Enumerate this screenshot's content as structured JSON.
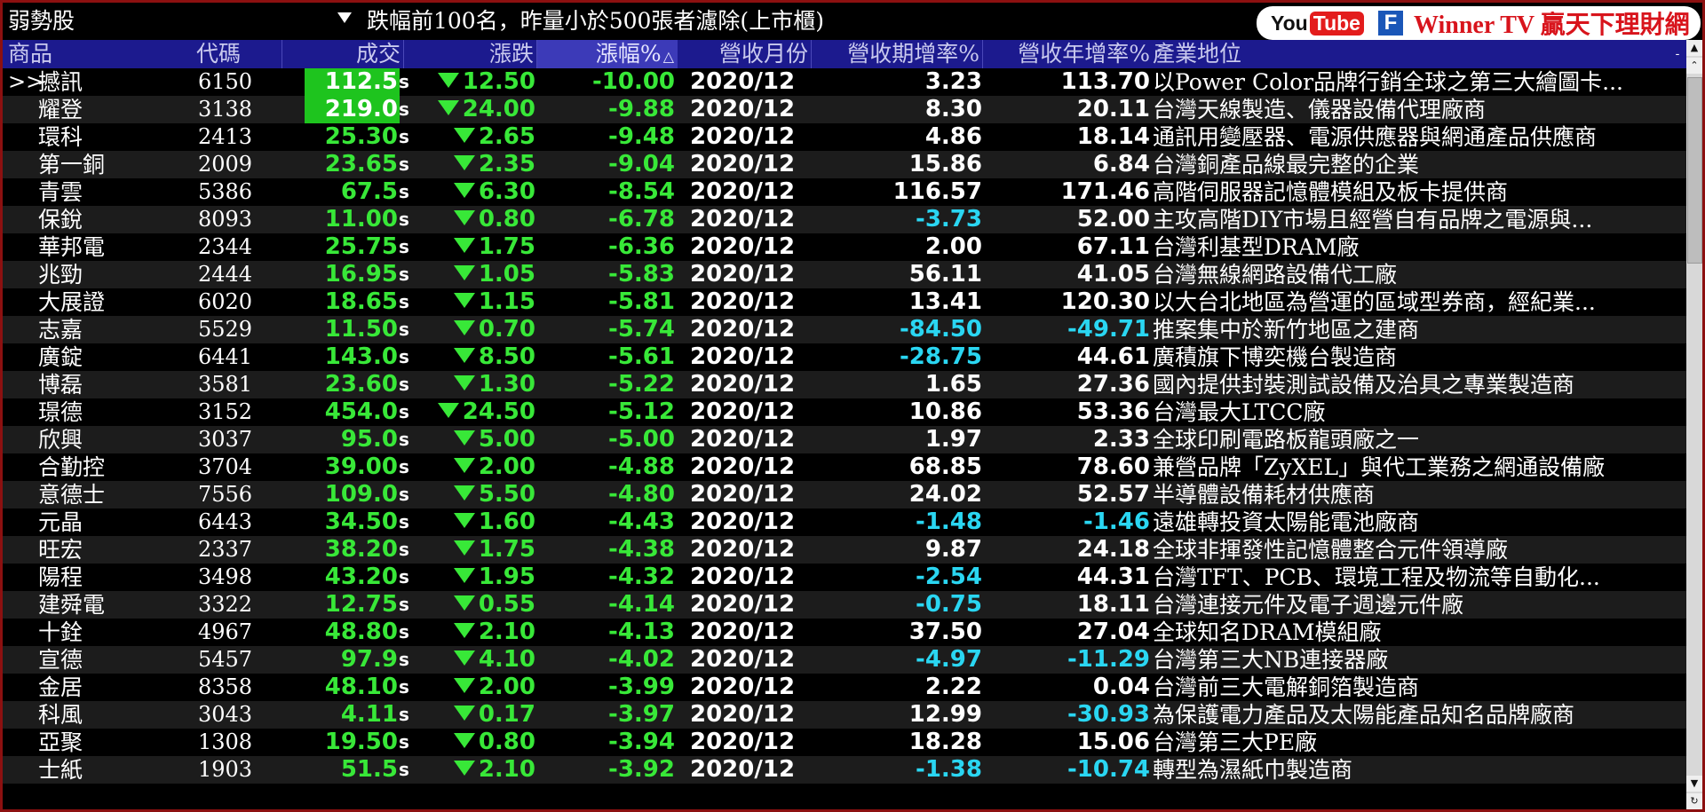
{
  "window": {
    "title_left": "弱勢股",
    "title_center": "跌幅前100名，昨量小於500張者濾除(上市櫃)"
  },
  "banner": {
    "you": "You",
    "tube": "Tube",
    "fb": "F",
    "brand": "Winner TV 贏天下理財網"
  },
  "columns": {
    "name": "商品",
    "code": "代碼",
    "price": "成交",
    "change": "漲跌",
    "pct": "漲幅%",
    "pct_sort_icon": "△",
    "month": "營收月份",
    "mom": "營收期增率%",
    "yoy": "營收年增率%",
    "industry": "產業地位"
  },
  "colors": {
    "down_green": "#38e838",
    "negative_cyan": "#2ad6f2",
    "header_blue": "#1c1a8e",
    "highlight_green": "#1ec41e"
  },
  "rows": [
    {
      "ptr": ">>",
      "name": "撼訊",
      "code": "6150",
      "price": "112.5",
      "s": "s",
      "chg": "12.50",
      "pct": "-10.00",
      "month": "2020/12",
      "mom": "3.23",
      "yoy": "113.70",
      "ind": "以Power Color品牌行銷全球之第三大繪圖卡..."
    },
    {
      "ptr": "",
      "name": "耀登",
      "code": "3138",
      "price": "219.0",
      "s": "s",
      "chg": "24.00",
      "pct": "-9.88",
      "month": "2020/12",
      "mom": "8.30",
      "yoy": "20.11",
      "ind": "台灣天線製造、儀器設備代理廠商"
    },
    {
      "ptr": "",
      "name": "環科",
      "code": "2413",
      "price": "25.30",
      "s": "s",
      "chg": "2.65",
      "pct": "-9.48",
      "month": "2020/12",
      "mom": "4.86",
      "yoy": "18.14",
      "ind": "通訊用變壓器、電源供應器與網通產品供應商"
    },
    {
      "ptr": "",
      "name": "第一銅",
      "code": "2009",
      "price": "23.65",
      "s": "s",
      "chg": "2.35",
      "pct": "-9.04",
      "month": "2020/12",
      "mom": "15.86",
      "yoy": "6.84",
      "ind": "台灣銅產品線最完整的企業"
    },
    {
      "ptr": "",
      "name": "青雲",
      "code": "5386",
      "price": "67.5",
      "s": "s",
      "chg": "6.30",
      "pct": "-8.54",
      "month": "2020/12",
      "mom": "116.57",
      "yoy": "171.46",
      "ind": "高階伺服器記憶體模組及板卡提供商"
    },
    {
      "ptr": "",
      "name": "保銳",
      "code": "8093",
      "price": "11.00",
      "s": "s",
      "chg": "0.80",
      "pct": "-6.78",
      "month": "2020/12",
      "mom": "-3.73",
      "yoy": "52.00",
      "ind": "主攻高階DIY市場且經營自有品牌之電源與..."
    },
    {
      "ptr": "",
      "name": "華邦電",
      "code": "2344",
      "price": "25.75",
      "s": "s",
      "chg": "1.75",
      "pct": "-6.36",
      "month": "2020/12",
      "mom": "2.00",
      "yoy": "67.11",
      "ind": "台灣利基型DRAM廠"
    },
    {
      "ptr": "",
      "name": "兆勁",
      "code": "2444",
      "price": "16.95",
      "s": "s",
      "chg": "1.05",
      "pct": "-5.83",
      "month": "2020/12",
      "mom": "56.11",
      "yoy": "41.05",
      "ind": "台灣無線網路設備代工廠"
    },
    {
      "ptr": "",
      "name": "大展證",
      "code": "6020",
      "price": "18.65",
      "s": "s",
      "chg": "1.15",
      "pct": "-5.81",
      "month": "2020/12",
      "mom": "13.41",
      "yoy": "120.30",
      "ind": "以大台北地區為營運的區域型券商，經紀業..."
    },
    {
      "ptr": "",
      "name": "志嘉",
      "code": "5529",
      "price": "11.50",
      "s": "s",
      "chg": "0.70",
      "pct": "-5.74",
      "month": "2020/12",
      "mom": "-84.50",
      "yoy": "-49.71",
      "ind": "推案集中於新竹地區之建商"
    },
    {
      "ptr": "",
      "name": "廣錠",
      "code": "6441",
      "price": "143.0",
      "s": "s",
      "chg": "8.50",
      "pct": "-5.61",
      "month": "2020/12",
      "mom": "-28.75",
      "yoy": "44.61",
      "ind": "廣積旗下博奕機台製造商"
    },
    {
      "ptr": "",
      "name": "博磊",
      "code": "3581",
      "price": "23.60",
      "s": "s",
      "chg": "1.30",
      "pct": "-5.22",
      "month": "2020/12",
      "mom": "1.65",
      "yoy": "27.36",
      "ind": "國內提供封裝測試設備及治具之專業製造商"
    },
    {
      "ptr": "",
      "name": "璟德",
      "code": "3152",
      "price": "454.0",
      "s": "s",
      "chg": "24.50",
      "pct": "-5.12",
      "month": "2020/12",
      "mom": "10.86",
      "yoy": "53.36",
      "ind": "台灣最大LTCC廠"
    },
    {
      "ptr": "",
      "name": "欣興",
      "code": "3037",
      "price": "95.0",
      "s": "s",
      "chg": "5.00",
      "pct": "-5.00",
      "month": "2020/12",
      "mom": "1.97",
      "yoy": "2.33",
      "ind": "全球印刷電路板龍頭廠之一"
    },
    {
      "ptr": "",
      "name": "合勤控",
      "code": "3704",
      "price": "39.00",
      "s": "s",
      "chg": "2.00",
      "pct": "-4.88",
      "month": "2020/12",
      "mom": "68.85",
      "yoy": "78.60",
      "ind": "兼營品牌「ZyXEL」與代工業務之網通設備廠"
    },
    {
      "ptr": "",
      "name": "意德士",
      "code": "7556",
      "price": "109.0",
      "s": "s",
      "chg": "5.50",
      "pct": "-4.80",
      "month": "2020/12",
      "mom": "24.02",
      "yoy": "52.57",
      "ind": "半導體設備耗材供應商"
    },
    {
      "ptr": "",
      "name": "元晶",
      "code": "6443",
      "price": "34.50",
      "s": "s",
      "chg": "1.60",
      "pct": "-4.43",
      "month": "2020/12",
      "mom": "-1.48",
      "yoy": "-1.46",
      "ind": "遠雄轉投資太陽能電池廠商"
    },
    {
      "ptr": "",
      "name": "旺宏",
      "code": "2337",
      "price": "38.20",
      "s": "s",
      "chg": "1.75",
      "pct": "-4.38",
      "month": "2020/12",
      "mom": "9.87",
      "yoy": "24.18",
      "ind": "全球非揮發性記憶體整合元件領導廠"
    },
    {
      "ptr": "",
      "name": "陽程",
      "code": "3498",
      "price": "43.20",
      "s": "s",
      "chg": "1.95",
      "pct": "-4.32",
      "month": "2020/12",
      "mom": "-2.54",
      "yoy": "44.31",
      "ind": "台灣TFT、PCB、環境工程及物流等自動化..."
    },
    {
      "ptr": "",
      "name": "建舜電",
      "code": "3322",
      "price": "12.75",
      "s": "s",
      "chg": "0.55",
      "pct": "-4.14",
      "month": "2020/12",
      "mom": "-0.75",
      "yoy": "18.11",
      "ind": "台灣連接元件及電子週邊元件廠"
    },
    {
      "ptr": "",
      "name": "十銓",
      "code": "4967",
      "price": "48.80",
      "s": "s",
      "chg": "2.10",
      "pct": "-4.13",
      "month": "2020/12",
      "mom": "37.50",
      "yoy": "27.04",
      "ind": "全球知名DRAM模組廠"
    },
    {
      "ptr": "",
      "name": "宣德",
      "code": "5457",
      "price": "97.9",
      "s": "s",
      "chg": "4.10",
      "pct": "-4.02",
      "month": "2020/12",
      "mom": "-4.97",
      "yoy": "-11.29",
      "ind": "台灣第三大NB連接器廠"
    },
    {
      "ptr": "",
      "name": "金居",
      "code": "8358",
      "price": "48.10",
      "s": "s",
      "chg": "2.00",
      "pct": "-3.99",
      "month": "2020/12",
      "mom": "2.22",
      "yoy": "0.04",
      "ind": "台灣前三大電解銅箔製造商"
    },
    {
      "ptr": "",
      "name": "科風",
      "code": "3043",
      "price": "4.11",
      "s": "s",
      "chg": "0.17",
      "pct": "-3.97",
      "month": "2020/12",
      "mom": "12.99",
      "yoy": "-30.93",
      "ind": "為保護電力產品及太陽能產品知名品牌廠商"
    },
    {
      "ptr": "",
      "name": "亞聚",
      "code": "1308",
      "price": "19.50",
      "s": "s",
      "chg": "0.80",
      "pct": "-3.94",
      "month": "2020/12",
      "mom": "18.28",
      "yoy": "15.06",
      "ind": "台灣第三大PE廠"
    },
    {
      "ptr": "",
      "name": "士紙",
      "code": "1903",
      "price": "51.5",
      "s": "s",
      "chg": "2.10",
      "pct": "-3.92",
      "month": "2020/12",
      "mom": "-1.38",
      "yoy": "-10.74",
      "ind": "轉型為濕紙巾製造商"
    }
  ]
}
